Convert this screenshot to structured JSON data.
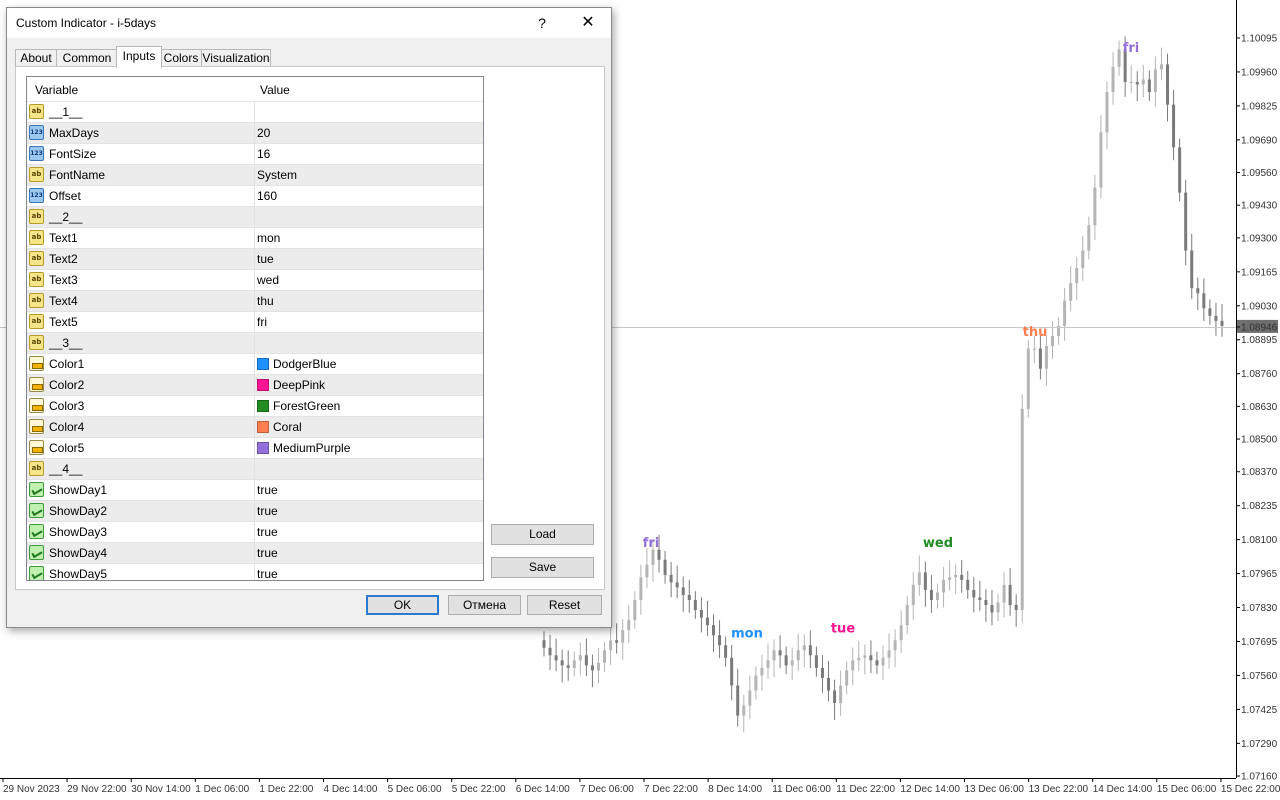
{
  "dialog": {
    "title": "Custom Indicator - i-5days",
    "help_label": "?",
    "close_label": "✕",
    "tabs": [
      "About",
      "Common",
      "Inputs",
      "Colors",
      "Visualization"
    ],
    "active_tab": "Inputs",
    "columns": {
      "variable": "Variable",
      "value": "Value"
    },
    "rows": [
      {
        "icon": "ab",
        "variable": "__1__",
        "value": ""
      },
      {
        "icon": "123",
        "variable": "MaxDays",
        "value": "20"
      },
      {
        "icon": "123",
        "variable": "FontSize",
        "value": "16"
      },
      {
        "icon": "ab",
        "variable": "FontName",
        "value": "System"
      },
      {
        "icon": "123",
        "variable": "Offset",
        "value": "160"
      },
      {
        "icon": "ab",
        "variable": "__2__",
        "value": ""
      },
      {
        "icon": "ab",
        "variable": "Text1",
        "value": "mon"
      },
      {
        "icon": "ab",
        "variable": "Text2",
        "value": "tue"
      },
      {
        "icon": "ab",
        "variable": "Text3",
        "value": "wed"
      },
      {
        "icon": "ab",
        "variable": "Text4",
        "value": "thu"
      },
      {
        "icon": "ab",
        "variable": "Text5",
        "value": "fri"
      },
      {
        "icon": "ab",
        "variable": "__3__",
        "value": ""
      },
      {
        "icon": "color",
        "variable": "Color1",
        "value": "DodgerBlue",
        "swatch": "#1e90ff"
      },
      {
        "icon": "color",
        "variable": "Color2",
        "value": "DeepPink",
        "swatch": "#ff1493"
      },
      {
        "icon": "color",
        "variable": "Color3",
        "value": "ForestGreen",
        "swatch": "#228b22"
      },
      {
        "icon": "color",
        "variable": "Color4",
        "value": "Coral",
        "swatch": "#ff7f50"
      },
      {
        "icon": "color",
        "variable": "Color5",
        "value": "MediumPurple",
        "swatch": "#9370db"
      },
      {
        "icon": "ab",
        "variable": "__4__",
        "value": ""
      },
      {
        "icon": "bool",
        "variable": "ShowDay1",
        "value": "true"
      },
      {
        "icon": "bool",
        "variable": "ShowDay2",
        "value": "true"
      },
      {
        "icon": "bool",
        "variable": "ShowDay3",
        "value": "true"
      },
      {
        "icon": "bool",
        "variable": "ShowDay4",
        "value": "true"
      },
      {
        "icon": "bool",
        "variable": "ShowDay5",
        "value": "true"
      }
    ],
    "load_label": "Load",
    "save_label": "Save",
    "ok_label": "OK",
    "cancel_label": "Отмена",
    "reset_label": "Reset"
  },
  "chart_data": {
    "type": "line",
    "price_axis": [
      "1.10095",
      "1.09960",
      "1.09825",
      "1.09690",
      "1.09560",
      "1.09430",
      "1.09300",
      "1.09165",
      "1.09030",
      "1.08946",
      "1.08895",
      "1.08760",
      "1.08630",
      "1.08500",
      "1.08370",
      "1.08235",
      "1.08100",
      "1.07965",
      "1.07830",
      "1.07695",
      "1.07560",
      "1.07425",
      "1.07290",
      "1.07160"
    ],
    "current_price": "1.08946",
    "time_axis": [
      "29 Nov 2023",
      "29 Nov 22:00",
      "30 Nov 14:00",
      "1 Dec 06:00",
      "1 Dec 22:00",
      "4 Dec 14:00",
      "5 Dec 06:00",
      "5 Dec 22:00",
      "6 Dec 14:00",
      "7 Dec 06:00",
      "7 Dec 22:00",
      "8 Dec 14:00",
      "11 Dec 06:00",
      "11 Dec 22:00",
      "12 Dec 14:00",
      "13 Dec 06:00",
      "13 Dec 22:00",
      "14 Dec 14:00",
      "15 Dec 06:00",
      "15 Dec 22:00"
    ],
    "day_labels": [
      {
        "text": "fri",
        "color": "#9370db",
        "price": 1.0809
      },
      {
        "text": "mon",
        "color": "#1e90ff",
        "price": 1.0773
      },
      {
        "text": "tue",
        "color": "#ff1493",
        "price": 1.0775
      },
      {
        "text": "wed",
        "color": "#228b22",
        "price": 1.0809
      },
      {
        "text": "thu",
        "color": "#ff7f50",
        "price": 1.0893
      },
      {
        "text": "fri",
        "color": "#9370db",
        "price": 1.1006
      }
    ],
    "close_prices": [
      1.0767,
      1.0764,
      1.0762,
      1.076,
      1.0759,
      1.0762,
      1.0764,
      1.076,
      1.0758,
      1.0761,
      1.0766,
      1.077,
      1.0769,
      1.0774,
      1.0778,
      1.0786,
      1.0795,
      1.08,
      1.0806,
      1.0802,
      1.0796,
      1.0793,
      1.0791,
      1.0788,
      1.0786,
      1.0782,
      1.0779,
      1.0776,
      1.0772,
      1.0768,
      1.0763,
      1.0752,
      1.074,
      1.0744,
      1.075,
      1.0756,
      1.0759,
      1.0762,
      1.0766,
      1.0764,
      1.076,
      1.0762,
      1.0766,
      1.0768,
      1.0764,
      1.0759,
      1.0755,
      1.075,
      1.0745,
      1.0752,
      1.0758,
      1.0762,
      1.0763,
      1.0764,
      1.0762,
      1.076,
      1.0763,
      1.0766,
      1.077,
      1.0776,
      1.0784,
      1.0792,
      1.0797,
      1.079,
      1.0786,
      1.0789,
      1.0794,
      1.0795,
      1.0796,
      1.0794,
      1.079,
      1.0787,
      1.0786,
      1.0784,
      1.0781,
      1.0785,
      1.0792,
      1.0784,
      1.0782,
      1.0862,
      1.0886,
      1.0886,
      1.0878,
      1.0887,
      1.0891,
      1.0895,
      1.0905,
      1.0912,
      1.0918,
      1.0925,
      1.0935,
      1.095,
      1.0972,
      1.0988,
      1.0998,
      1.1005,
      1.0992,
      1.0992,
      1.0991,
      1.0993,
      1.0988,
      1.0997,
      1.0999,
      1.0983,
      1.0966,
      1.0948,
      1.0925,
      1.091,
      1.0908,
      1.0902,
      1.0899,
      1.0897,
      1.0895
    ]
  }
}
